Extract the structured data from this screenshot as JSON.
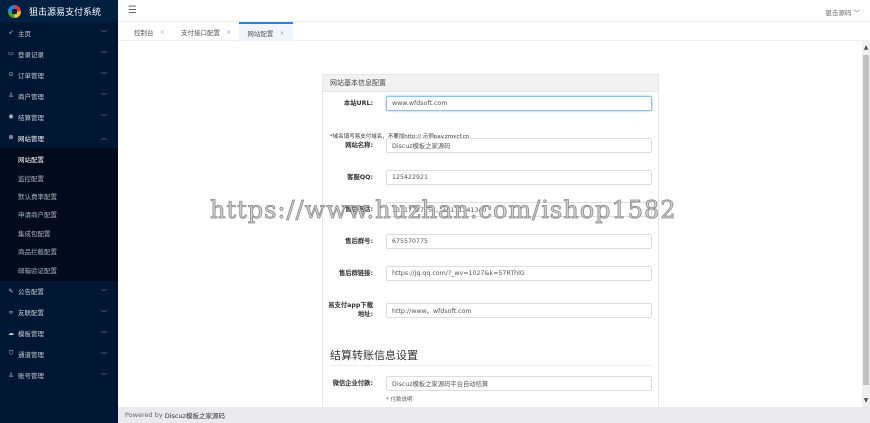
{
  "app": {
    "title": "狙击源易支付系统",
    "user": "狙击源码"
  },
  "sidebar": {
    "items": [
      {
        "label": "主页",
        "icon": "rocket-icon"
      },
      {
        "label": "登录记录",
        "icon": "log-icon"
      },
      {
        "label": "订单管理",
        "icon": "order-icon"
      },
      {
        "label": "商户管理",
        "icon": "user-icon"
      },
      {
        "label": "结算管理",
        "icon": "settle-icon"
      },
      {
        "label": "网站管理",
        "icon": "settings-icon"
      }
    ],
    "sub_items": [
      "网站配置",
      "监控配置",
      "默认费率配置",
      "申请商户配置",
      "集成包配置",
      "商品拦截配置",
      "邮箱验证配置"
    ],
    "items_after": [
      {
        "label": "公告配置",
        "icon": "pencil-icon"
      },
      {
        "label": "友联配置",
        "icon": "link-icon"
      },
      {
        "label": "模板管理",
        "icon": "cloud-icon"
      },
      {
        "label": "通道管理",
        "icon": "shield-icon"
      },
      {
        "label": "账号管理",
        "icon": "account-icon"
      }
    ]
  },
  "tabs": [
    "控制台",
    "支付接口配置",
    "网站配置"
  ],
  "panel": {
    "title": "网站基本信息配置",
    "fields": [
      {
        "label": "本站URL:",
        "value": "www.wfdsoft.com"
      },
      {
        "label": "网站名称:",
        "value": "Discuz模板之家源码"
      },
      {
        "label": "客服QQ:",
        "value": "125422921"
      },
      {
        "label": "售后电话:",
        "value": "13117727751、18171341340"
      },
      {
        "label": "售后群号:",
        "value": "675570775"
      },
      {
        "label": "售后群链接:",
        "value": "https://jq.qq.com/?_wv=1027&k=57RThlG"
      },
      {
        "label": "易支付app下载地址:",
        "value": "http://www。wfdsoft.com"
      }
    ],
    "hint": "*域名填写易支付域名，不要加http:// 示例pay.zmycf.cn",
    "section": "结算转账信息设置",
    "wx_label": "微信企业付款:",
    "wx_value": "Discuz模板之家源码平台自动结算",
    "wx_note": "* 付款说明"
  },
  "footer": {
    "prefix": "Powered by",
    "brand": "Discuz模板之家源码"
  },
  "watermark": "https://www.huzhan.com/ishop1582"
}
